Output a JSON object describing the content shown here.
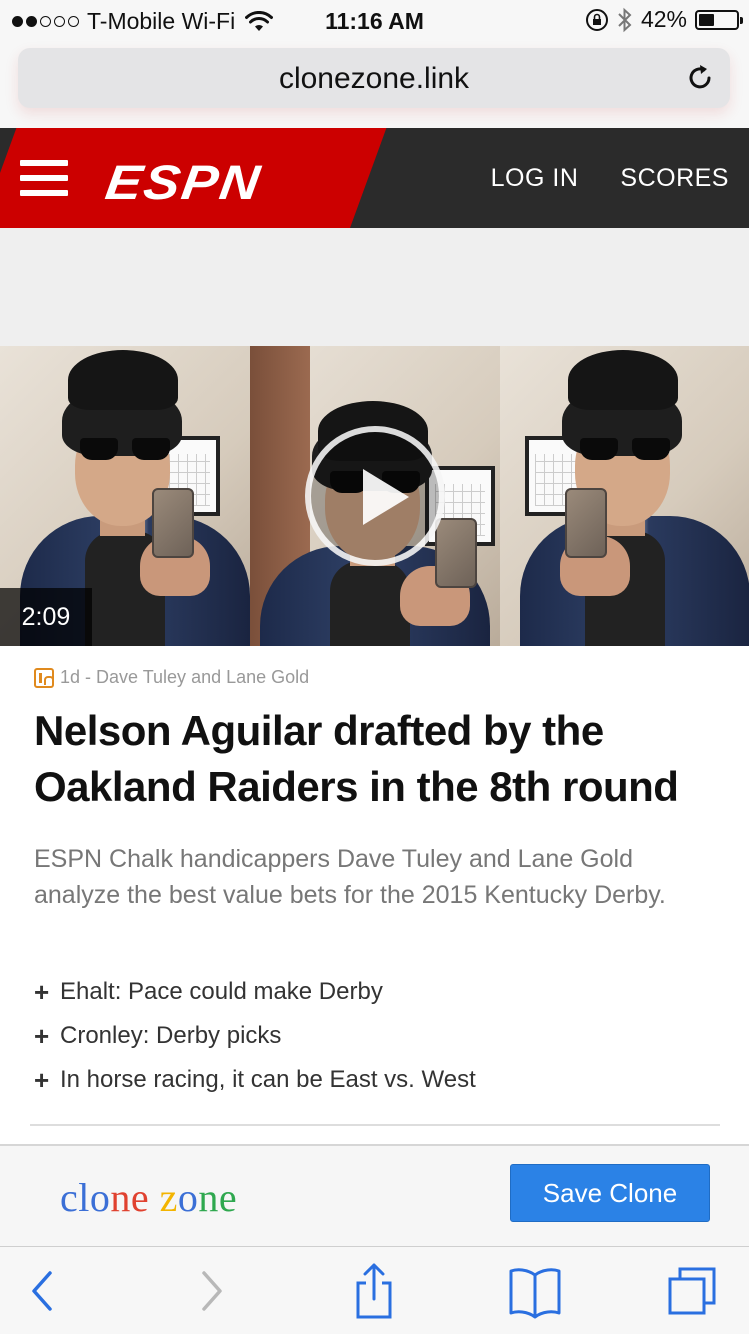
{
  "status_bar": {
    "carrier": "T-Mobile Wi-Fi",
    "time": "11:16 AM",
    "battery": "42%",
    "battery_level": 0.42,
    "signal_bars_filled": 2,
    "signal_bars_total": 5
  },
  "browser": {
    "url": "clonezone.link"
  },
  "espn_header": {
    "logo": "ESPN",
    "nav": [
      "LOG IN",
      "SCORES"
    ],
    "brand_red": "#cc0000"
  },
  "video": {
    "duration": "2:09"
  },
  "article": {
    "meta": "1d - Dave Tuley and Lane Gold",
    "headline": "Nelson Aguilar drafted by the Oakland Raiders in the 8th round",
    "summary": "ESPN Chalk handicappers Dave Tuley and Lane Gold analyze the best value bets for the 2015 Kentucky Derby.",
    "related": [
      "Ehalt: Pace could make Derby",
      "Cronley: Derby picks",
      "In horse racing, it can be East vs. West"
    ]
  },
  "clone_zone": {
    "logo_parts": [
      "clo",
      "ne",
      " z",
      "o",
      "ne"
    ],
    "save_label": "Save Clone",
    "button_color": "#2b82e6"
  },
  "toolbar": {
    "icons": [
      "back-icon",
      "forward-icon",
      "share-icon",
      "bookmarks-icon",
      "tabs-icon"
    ]
  }
}
